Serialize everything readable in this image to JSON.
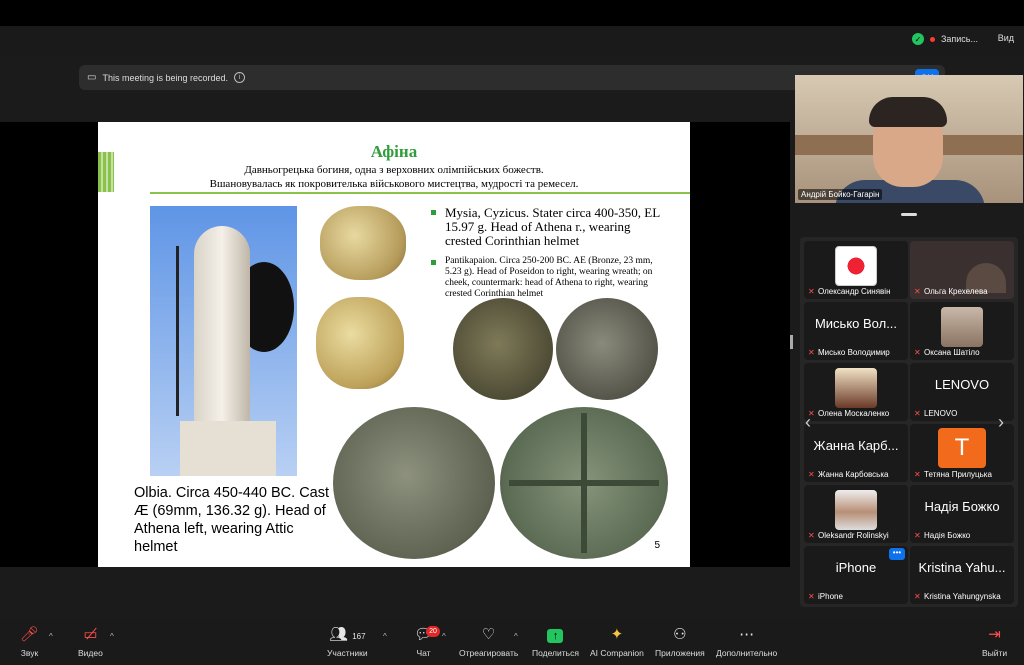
{
  "top": {
    "recording_label": "Запись...",
    "view_label": "Вид"
  },
  "banner": {
    "text": "This meeting is being recorded.",
    "ok_label": "OK"
  },
  "slide": {
    "title": "Афіна",
    "subtitle_line1": "Давньогрецька богиня, одна з верховних олімпійських божеств.",
    "subtitle_line2": "Вшановувалась як покровителька військового мистецтва, мудрості та ремесел.",
    "bullet1": "Mysia, Cyzicus. Stater circa 400-350, EL 15.97 g. Head of Athena r., wearing crested Corinthian helmet",
    "bullet2": "Pantikapaion. Circa 250-200 BC. AE (Bronze, 23 mm, 5.23 g). Head of Poseidon to right, wearing wreath; on cheek, countermark: head of Athena to right, wearing crested Corinthian helmet",
    "caption": "Olbia. Circa 450-440 BC. Cast Æ (69mm, 136.32 g). Head of Athena left, wearing Attic helmet",
    "page_number": "5"
  },
  "self_view": {
    "name": "Андрій Бойко-Гагарін"
  },
  "participants": [
    {
      "name": "Олександр Синявін",
      "big": ""
    },
    {
      "name": "Ольга Крехелева",
      "big": ""
    },
    {
      "name": "Мисько Володимир",
      "big": "Мисько Вол..."
    },
    {
      "name": "Оксана Шатіло",
      "big": ""
    },
    {
      "name": "Олена Москаленко",
      "big": ""
    },
    {
      "name": "LENOVO",
      "big": "LENOVO"
    },
    {
      "name": "Жанна Карбовська",
      "big": "Жанна Карб..."
    },
    {
      "name": "Тетяна Прилуцька",
      "big": "T"
    },
    {
      "name": "Oleksandr Rolinskyi",
      "big": ""
    },
    {
      "name": "Надія Божко",
      "big": "Надія Божко"
    },
    {
      "name": "iPhone",
      "big": "iPhone"
    },
    {
      "name": "Kristina Yahungynska",
      "big": "Kristina Yahu..."
    }
  ],
  "toolbar": {
    "audio": "Звук",
    "video": "Видео",
    "participants": "Участники",
    "participants_count": "167",
    "chat": "Чат",
    "chat_badge": "20",
    "react": "Отреагировать",
    "share": "Поделиться",
    "ai": "AI Companion",
    "apps": "Приложения",
    "more": "Дополнительно",
    "leave": "Выйти"
  },
  "colors": {
    "accent": "#0e72ed",
    "share_green": "#22c55e",
    "slide_title_green": "#2e9d3a"
  }
}
